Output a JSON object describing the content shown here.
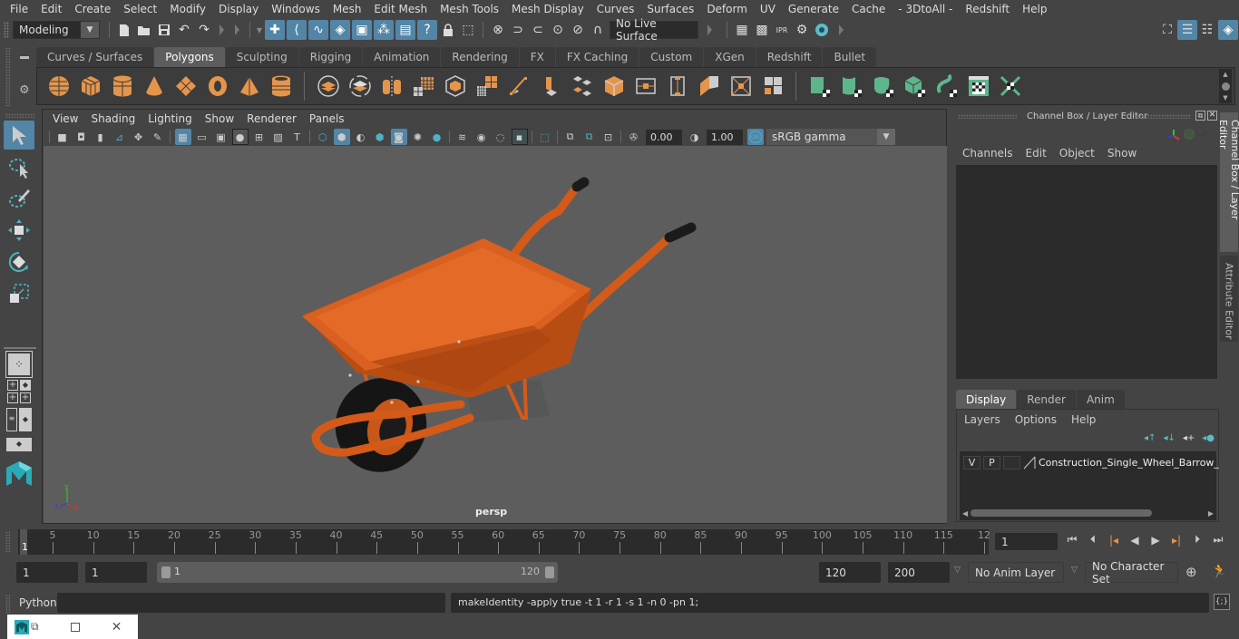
{
  "menubar": {
    "items": [
      "File",
      "Edit",
      "Create",
      "Select",
      "Modify",
      "Display",
      "Windows",
      "Mesh",
      "Edit Mesh",
      "Mesh Tools",
      "Mesh Display",
      "Curves",
      "Surfaces",
      "Deform",
      "UV",
      "Generate",
      "Cache",
      "- 3DtoAll -",
      "Redshift",
      "Help"
    ]
  },
  "statusline": {
    "workspace": "Modeling",
    "live_surface": "No Live Surface"
  },
  "shelf": {
    "tabs": [
      "Curves / Surfaces",
      "Polygons",
      "Sculpting",
      "Rigging",
      "Animation",
      "Rendering",
      "FX",
      "FX Caching",
      "Custom",
      "XGen",
      "Redshift",
      "Bullet"
    ],
    "active_tab": "Polygons"
  },
  "viewport": {
    "menu": [
      "View",
      "Shading",
      "Lighting",
      "Show",
      "Renderer",
      "Panels"
    ],
    "exposure": "0.00",
    "gamma": "1.00",
    "color_space": "sRGB gamma",
    "color_mgmt_badge": "ON",
    "camera_label": "persp",
    "axis": {
      "x": "x",
      "y": "y",
      "z": "z"
    },
    "model_color": "#e0661f"
  },
  "channel_box": {
    "title": "Channel Box / Layer Editor",
    "menu": [
      "Channels",
      "Edit",
      "Object",
      "Show"
    ]
  },
  "layer_editor": {
    "tabs": [
      "Display",
      "Render",
      "Anim"
    ],
    "active_tab": "Display",
    "menu": [
      "Layers",
      "Options",
      "Help"
    ],
    "layers": [
      {
        "v": "V",
        "p": "P",
        "name": "Construction_Single_Wheel_Barrow_"
      }
    ]
  },
  "side_tabs": [
    "Channel Box / Layer Editor",
    "Attribute Editor"
  ],
  "timeline": {
    "current_frame_marker": "1",
    "ticks": [
      "5",
      "10",
      "15",
      "20",
      "25",
      "30",
      "35",
      "40",
      "45",
      "50",
      "55",
      "60",
      "65",
      "70",
      "75",
      "80",
      "85",
      "90",
      "95",
      "100",
      "105",
      "110",
      "115",
      "12"
    ],
    "current_frame": "1"
  },
  "range": {
    "start": "1",
    "playback_start": "1",
    "slider_start": "1",
    "slider_end": "120",
    "playback_end": "120",
    "end": "200",
    "anim_layer": "No Anim Layer",
    "character_set": "No Character Set"
  },
  "command": {
    "language": "Python",
    "input": "",
    "result": "makeIdentity -apply true -t 1 -r 1 -s 1 -n 0 -pn 1;"
  }
}
